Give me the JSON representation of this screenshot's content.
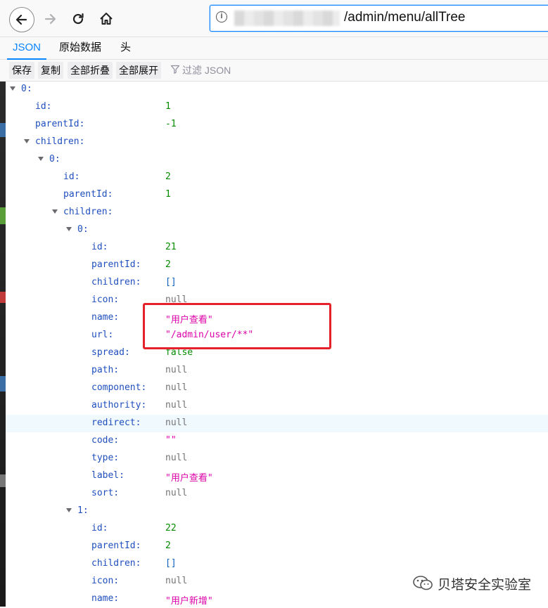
{
  "browser": {
    "url_path": "/admin/menu/allTree"
  },
  "tabs": [
    {
      "label": "JSON"
    },
    {
      "label": "原始数据"
    },
    {
      "label": "头"
    }
  ],
  "toolbar": {
    "save_label": "保存",
    "copy_label": "复制",
    "collapse_all_label": "全部折叠",
    "expand_all_label": "全部展开",
    "filter_placeholder": "过滤 JSON"
  },
  "json_rows": [
    {
      "key": "0:",
      "value": "",
      "type": "node",
      "indent": 0,
      "twisty": true
    },
    {
      "key": "id:",
      "value": "1",
      "type": "num",
      "indent": 1
    },
    {
      "key": "parentId:",
      "value": "-1",
      "type": "num",
      "indent": 1
    },
    {
      "key": "children:",
      "value": "",
      "type": "node",
      "indent": 1,
      "twisty": true
    },
    {
      "key": "0:",
      "value": "",
      "type": "node",
      "indent": 2,
      "twisty": true
    },
    {
      "key": "id:",
      "value": "2",
      "type": "num",
      "indent": 3
    },
    {
      "key": "parentId:",
      "value": "1",
      "type": "num",
      "indent": 3
    },
    {
      "key": "children:",
      "value": "",
      "type": "node",
      "indent": 3,
      "twisty": true
    },
    {
      "key": "0:",
      "value": "",
      "type": "node",
      "indent": 4,
      "twisty": true
    },
    {
      "key": "id:",
      "value": "21",
      "type": "num",
      "indent": 5
    },
    {
      "key": "parentId:",
      "value": "2",
      "type": "num",
      "indent": 5
    },
    {
      "key": "children:",
      "value": "[]",
      "type": "arr",
      "indent": 5
    },
    {
      "key": "icon:",
      "value": "null",
      "type": "null",
      "indent": 5
    },
    {
      "key": "name:",
      "value": "\"用户查看\"",
      "type": "str",
      "indent": 5
    },
    {
      "key": "url:",
      "value": "\"/admin/user/**\"",
      "type": "str",
      "indent": 5
    },
    {
      "key": "spread:",
      "value": "false",
      "type": "bool",
      "indent": 5
    },
    {
      "key": "path:",
      "value": "null",
      "type": "null",
      "indent": 5
    },
    {
      "key": "component:",
      "value": "null",
      "type": "null",
      "indent": 5
    },
    {
      "key": "authority:",
      "value": "null",
      "type": "null",
      "indent": 5
    },
    {
      "key": "redirect:",
      "value": "null",
      "type": "null",
      "indent": 5,
      "highlight": true
    },
    {
      "key": "code:",
      "value": "\"\"",
      "type": "str",
      "indent": 5
    },
    {
      "key": "type:",
      "value": "null",
      "type": "null",
      "indent": 5
    },
    {
      "key": "label:",
      "value": "\"用户查看\"",
      "type": "str",
      "indent": 5
    },
    {
      "key": "sort:",
      "value": "null",
      "type": "null",
      "indent": 5
    },
    {
      "key": "1:",
      "value": "",
      "type": "node",
      "indent": 4,
      "twisty": true
    },
    {
      "key": "id:",
      "value": "22",
      "type": "num",
      "indent": 5
    },
    {
      "key": "parentId:",
      "value": "2",
      "type": "num",
      "indent": 5
    },
    {
      "key": "children:",
      "value": "[]",
      "type": "arr",
      "indent": 5
    },
    {
      "key": "icon:",
      "value": "null",
      "type": "null",
      "indent": 5
    },
    {
      "key": "name:",
      "value": "\"用户新增\"",
      "type": "str",
      "indent": 5
    }
  ],
  "watermark": {
    "text": "贝塔安全实验室"
  },
  "colors": {
    "accent": "#0a84ff",
    "highlight_box": "#e5222b"
  }
}
